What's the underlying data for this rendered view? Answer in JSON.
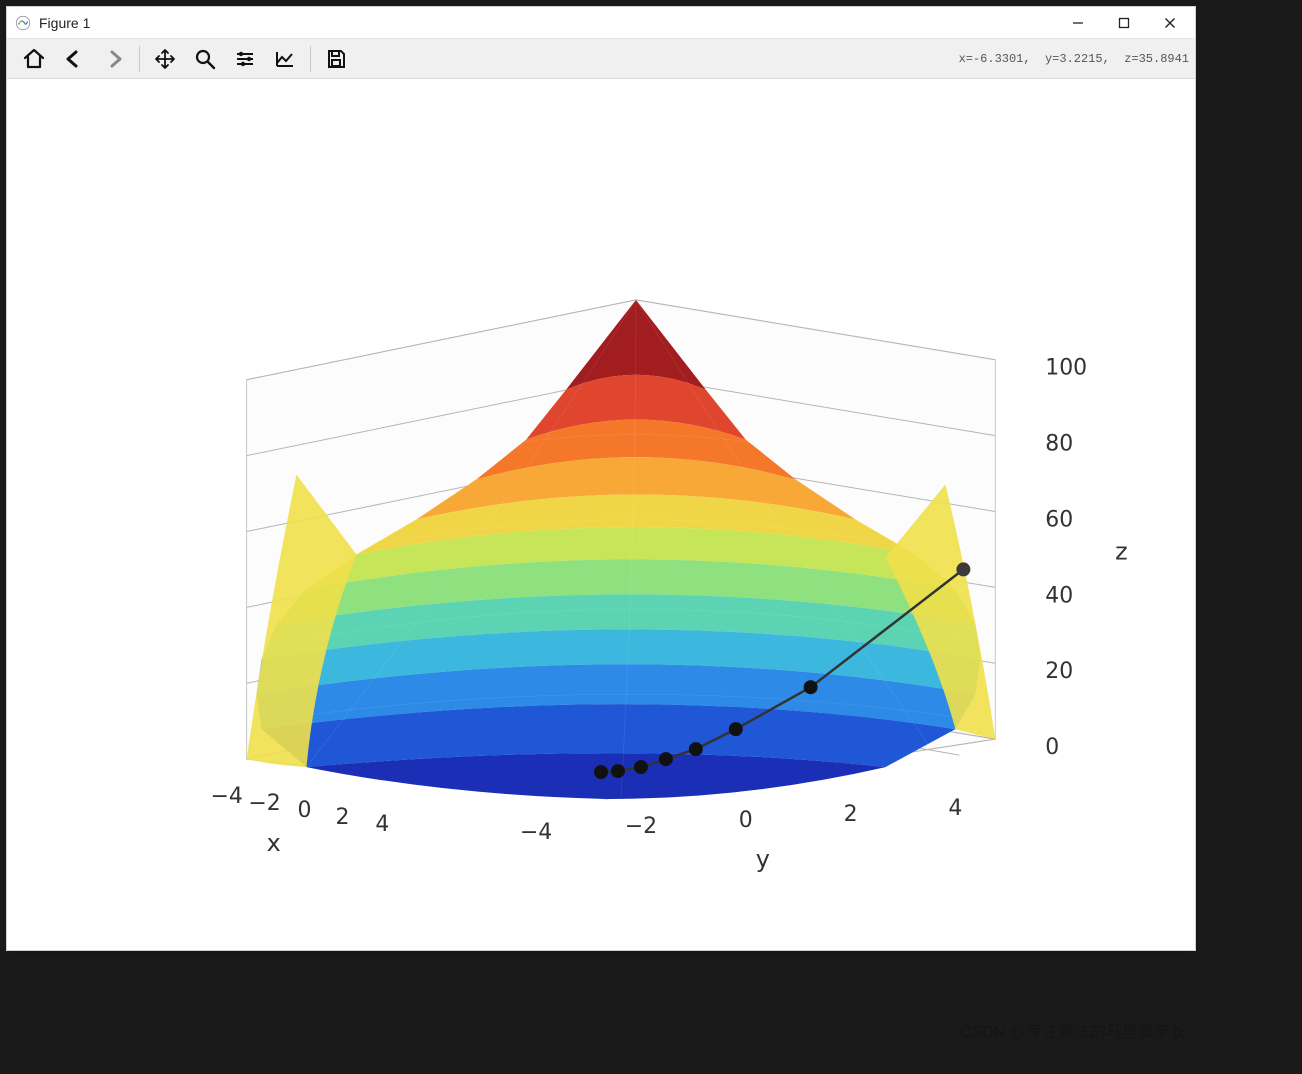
{
  "window": {
    "title": "Figure 1"
  },
  "toolbar": {
    "icons": [
      "home",
      "back",
      "forward",
      "pan",
      "zoom",
      "config",
      "edit",
      "save"
    ]
  },
  "coord_readout": "x=-6.3301,  y=3.2215,  z=35.8941",
  "watermark": "CSDN @专注算法的马里奥学长",
  "chart_data": {
    "type": "surface3d",
    "function": "z = x^2 + y^2",
    "xlabel": "x",
    "ylabel": "y",
    "zlabel": "z",
    "x_range": [
      -5,
      5
    ],
    "y_range": [
      -5,
      5
    ],
    "z_range": [
      0,
      110
    ],
    "x_ticks": [
      -4,
      -2,
      0,
      2,
      4
    ],
    "y_ticks": [
      -4,
      -2,
      0,
      2,
      4
    ],
    "z_ticks": [
      0,
      20,
      40,
      60,
      80,
      100
    ],
    "colormap": "rainbow",
    "trajectory": {
      "description": "gradient-descent path on surface",
      "points": [
        {
          "x": 5.0,
          "y": 5.0,
          "z": 50.0
        },
        {
          "x": 3.0,
          "y": 3.0,
          "z": 18.0
        },
        {
          "x": 1.8,
          "y": 1.8,
          "z": 6.5
        },
        {
          "x": 1.1,
          "y": 1.1,
          "z": 2.4
        },
        {
          "x": 0.6,
          "y": 0.6,
          "z": 0.72
        },
        {
          "x": 0.2,
          "y": 0.2,
          "z": 0.08
        },
        {
          "x": 0.0,
          "y": 0.0,
          "z": 0.0
        }
      ]
    }
  }
}
